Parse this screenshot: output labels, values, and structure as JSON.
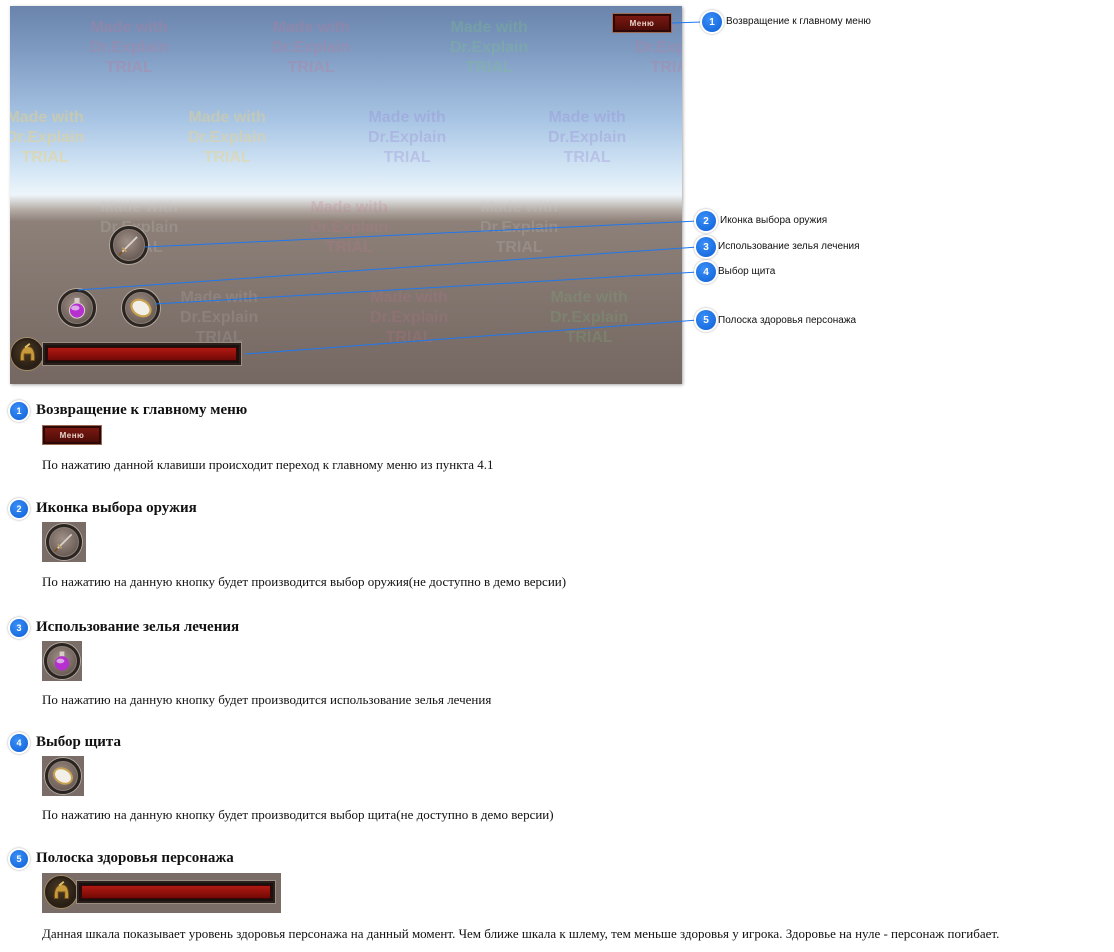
{
  "screenshot": {
    "menu_button_label": "Меню",
    "watermark_text": "Made with\nDr.Explain\nTRIAL",
    "icons": [
      "sword-icon",
      "potion-icon",
      "shield-icon",
      "helmet-icon"
    ],
    "health_level": 1.0,
    "colors": {
      "callout_blue": "#1976f0",
      "health_red": "#a31610"
    }
  },
  "callouts": [
    {
      "num": "1",
      "label": "Возвращение к главному меню"
    },
    {
      "num": "2",
      "label": "Иконка выбора оружия"
    },
    {
      "num": "3",
      "label": "Использование зелья лечения"
    },
    {
      "num": "4",
      "label": "Выбор щита"
    },
    {
      "num": "5",
      "label": "Полоска здоровья персонажа"
    }
  ],
  "sections": [
    {
      "num": "1",
      "title": "Возвращение к главному меню",
      "image_label": "Меню",
      "description": "По нажатию данной клавиши происходит переход к главному меню из пункта 4.1"
    },
    {
      "num": "2",
      "title": "Иконка выбора оружия",
      "description": "По нажатию на данную кнопку будет производится выбор оружия(не доступно в демо версии)"
    },
    {
      "num": "3",
      "title": "Использование зелья лечения",
      "description": "По нажатию на данную кнопку будет производится использование зелья лечения"
    },
    {
      "num": "4",
      "title": "Выбор щита",
      "description": "По нажатию на данную кнопку будет производится выбор щита(не доступно в демо версии)"
    },
    {
      "num": "5",
      "title": "Полоска здоровья персонажа",
      "description": "Данная шкала показывает уровень здоровья персонажа на данный момент. Чем ближе шкала к шлему, тем меньше здоровья у игрока. Здоровье на нуле - персонаж погибает."
    }
  ]
}
